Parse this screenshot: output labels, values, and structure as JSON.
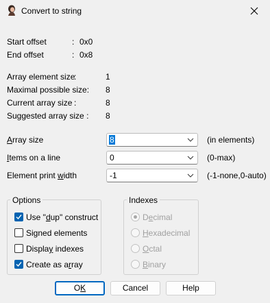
{
  "window": {
    "title": "Convert to string",
    "close_icon": "close-icon"
  },
  "offsets": {
    "start_label": "Start offset",
    "start_value": "0x0",
    "end_label": "End offset",
    "end_value": "0x8"
  },
  "info": {
    "element_size_label": "Array element size",
    "element_size_value": "1",
    "max_size_label": "Maximal possible size:",
    "max_size_value": "8",
    "current_size_label": "Current array size",
    "current_size_value": "8",
    "suggested_size_label": "Suggested array size :",
    "suggested_size_value": "8"
  },
  "fields": {
    "array_size": {
      "label_pre": "",
      "label_u": "A",
      "label_post": "rray size",
      "value": "8",
      "hint": "(in elements)"
    },
    "items_on_line": {
      "label_pre": "",
      "label_u": "I",
      "label_post": "tems on a line",
      "value": "0",
      "hint": "(0-max)"
    },
    "print_width": {
      "label_pre": "Element print ",
      "label_u": "w",
      "label_post": "idth",
      "value": "-1",
      "hint": "(-1-none,0-auto)"
    }
  },
  "options": {
    "title": "Options",
    "use_dup": {
      "pre": "Use \"",
      "u": "d",
      "post": "up\" construct",
      "checked": true
    },
    "signed": {
      "pre": "Si",
      "u": "g",
      "post": "ned elements",
      "checked": false
    },
    "display_indexes": {
      "pre": "Displa",
      "u": "y",
      "post": " indexes",
      "checked": false
    },
    "create_array": {
      "pre": "Create as a",
      "u": "r",
      "post": "ray",
      "checked": true
    }
  },
  "indexes": {
    "title": "Indexes",
    "decimal": {
      "pre": "D",
      "u": "e",
      "post": "cimal",
      "selected": true
    },
    "hexadecimal": {
      "pre": "",
      "u": "H",
      "post": "exadecimal",
      "selected": false
    },
    "octal": {
      "pre": "",
      "u": "O",
      "post": "ctal",
      "selected": false
    },
    "binary": {
      "pre": "",
      "u": "B",
      "post": "inary",
      "selected": false
    }
  },
  "buttons": {
    "ok": {
      "pre": "O",
      "u": "K",
      "post": ""
    },
    "cancel": "Cancel",
    "help": "Help"
  },
  "colors": {
    "accent": "#0067c0",
    "checkbox_fill": "#0063b1",
    "background": "#f0f0f0"
  }
}
